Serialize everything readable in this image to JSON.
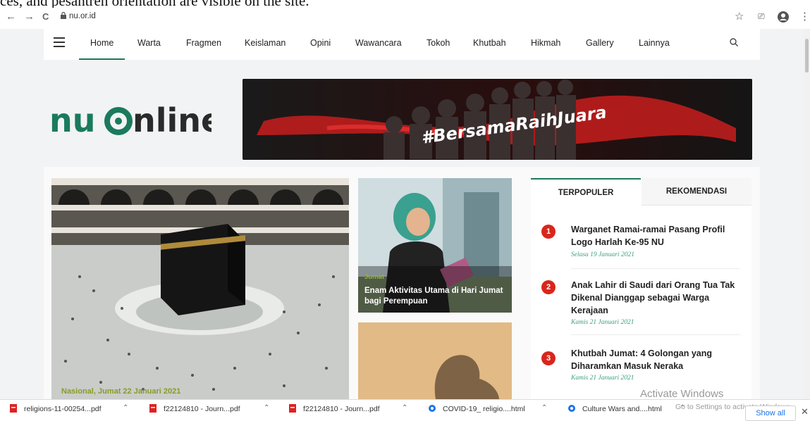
{
  "caption": "ces, and pesantren orientation are visible on the site.",
  "browser": {
    "url": "nu.or.id",
    "back": "←",
    "forward": "→",
    "reload": "C",
    "star": "☆",
    "cast": "⎚",
    "menu": "⋮"
  },
  "nav": {
    "items": [
      "Home",
      "Warta",
      "Fragmen",
      "Keislaman",
      "Opini",
      "Wawancara",
      "Tokoh",
      "Khutbah",
      "Hikmah",
      "Gallery",
      "Lainnya"
    ],
    "active": "Home"
  },
  "logo": {
    "text": "nuonline"
  },
  "banner": {
    "text": "#BersamaRaihJuara"
  },
  "featured": {
    "main_caption": "Nasional, Jumat 22 Januari 2021",
    "card1_tag": "Jumat",
    "card1_title": "Enam Aktivitas Utama di Hari Jumat bagi Perempuan"
  },
  "sidebar": {
    "tabs": [
      "TERPOPULER",
      "REKOMENDASI"
    ],
    "active_tab": "TERPOPULER",
    "items": [
      {
        "num": "1",
        "title": "Warganet Ramai-ramai Pasang Profil Logo Harlah Ke-95 NU",
        "date": "Selasa 19 Januari 2021"
      },
      {
        "num": "2",
        "title": "Anak Lahir di Saudi dari Orang Tua Tak Dikenal Dianggap sebagai Warga Kerajaan",
        "date": "Kamis 21 Januari 2021"
      },
      {
        "num": "3",
        "title": "Khutbah Jumat: 4 Golongan yang Diharamkan Masuk Neraka",
        "date": "Kamis 21 Januari 2021"
      }
    ]
  },
  "watermark": {
    "line1": "Activate Windows",
    "line2": "Go to Settings to activate Windows."
  },
  "downloads": {
    "items": [
      "religions-11-00254...pdf",
      "f22124810 - Journ...pdf",
      "f22124810 - Journ...pdf",
      "COVID-19_ religio....html",
      "Culture Wars and....html"
    ],
    "show_all": "Show all",
    "close": "✕"
  },
  "colors": {
    "brand_green": "#1a7a5e",
    "badge_red": "#d9261c",
    "date_green": "#3aa07a"
  }
}
